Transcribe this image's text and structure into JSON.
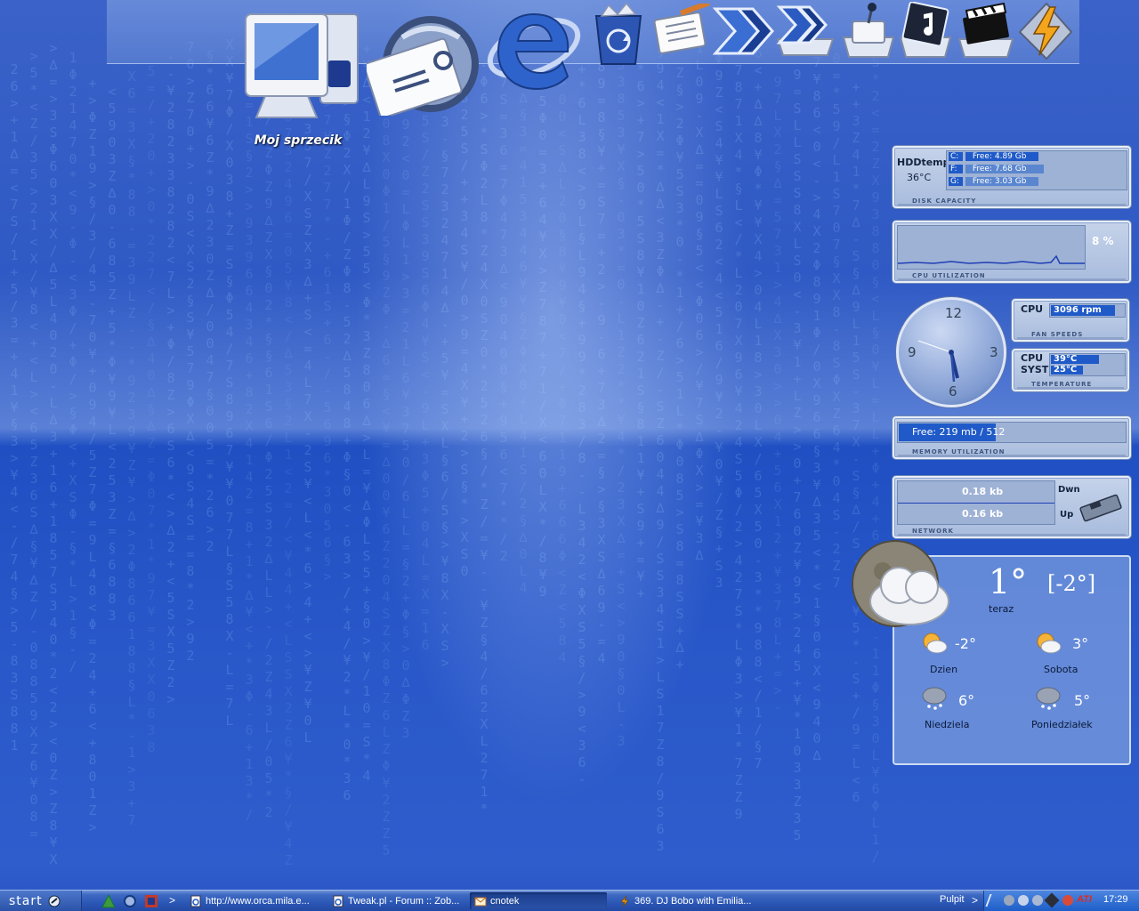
{
  "desktop": {
    "icon_label": "Moj sprzecik",
    "dock_icons": [
      "computer-icon",
      "mail-icon",
      "internet-explorer-icon",
      "recycle-bin-icon",
      "notepad-icon",
      "arrow-icon",
      "arrow-folder-icon",
      "games-folder-icon",
      "music-folder-icon",
      "video-folder-icon",
      "winamp-icon"
    ]
  },
  "widgets": {
    "disk": {
      "title": "HDDtemp",
      "temp": "36°C",
      "drives": [
        {
          "letter": "C:",
          "text": "Free:  4.89 Gb"
        },
        {
          "letter": "F:",
          "text": "Free:  7.68 Gb"
        },
        {
          "letter": "G:",
          "text": "Free:  3.03 Gb"
        }
      ],
      "label": "DISK CAPACITY"
    },
    "cpu": {
      "percent": "8 %",
      "label": "CPU UTILIZATION"
    },
    "fan": {
      "name": "CPU",
      "value": "3096 rpm",
      "label": "FAN SPEEDS"
    },
    "temperature": {
      "rows": [
        {
          "name": "CPU",
          "value": "39°C"
        },
        {
          "name": "SYST",
          "value": "25°C"
        }
      ],
      "label": "TEMPERATURE"
    },
    "clock": {
      "numerals": [
        "12",
        "3",
        "6",
        "9"
      ]
    },
    "memory": {
      "text": "Free: 219 mb / 512",
      "label": "MEMORY UTILIZATION",
      "used_fraction": 0.43
    },
    "network": {
      "down_value": "0.18 kb",
      "up_value": "0.16 kb",
      "down_label": "Dwn",
      "up_label": "Up",
      "label": "NETWORK"
    },
    "weather": {
      "temp_now": "1°",
      "feels": "[-2°]",
      "now_label": "teraz",
      "days": [
        {
          "temp": "-2°",
          "name": "Dzien",
          "icon": "sun-cloud-icon"
        },
        {
          "temp": "3°",
          "name": "Sobota",
          "icon": "sun-cloud-icon"
        },
        {
          "temp": "6°",
          "name": "Niedziela",
          "icon": "snow-cloud-icon"
        },
        {
          "temp": "5°",
          "name": "Poniedziałek",
          "icon": "snow-cloud-icon"
        }
      ]
    }
  },
  "taskbar": {
    "start_label": "start",
    "quick_launch": [
      "winamp-agent-icon",
      "quick-ie-icon",
      "media-icon"
    ],
    "more": ">",
    "items": [
      {
        "label": "http://www.orca.mila.e...",
        "icon": "ie-page-icon",
        "active": false
      },
      {
        "label": "Tweak.pl - Forum :: Zob...",
        "icon": "ie-page-icon",
        "active": false
      },
      {
        "label": "cnotek",
        "icon": "envelope-icon",
        "active": true
      },
      {
        "label": "369. DJ Bobo with Emilia...",
        "icon": "winamp-small-icon",
        "active": false
      }
    ],
    "pulpit": "Pulpit",
    "tray_icons": [
      "ati-icon",
      "network-tray-icon"
    ],
    "ati_label": "ATI",
    "time": "17:29"
  }
}
